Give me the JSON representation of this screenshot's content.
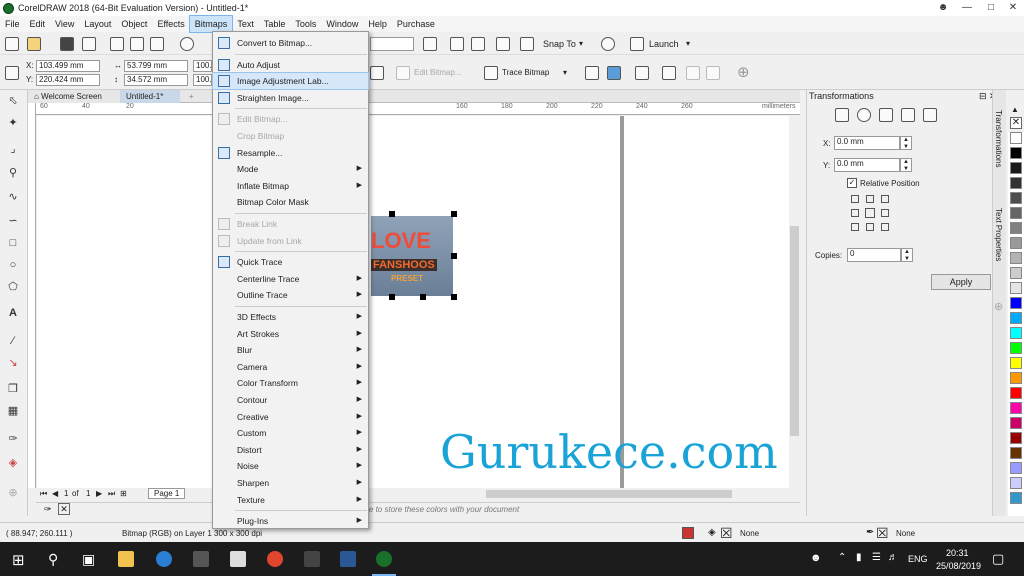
{
  "window": {
    "title": "CorelDRAW 2018 (64-Bit Evaluation Version) - Untitled-1*"
  },
  "menubar": [
    "File",
    "Edit",
    "View",
    "Layout",
    "Object",
    "Effects",
    "Bitmaps",
    "Text",
    "Table",
    "Tools",
    "Window",
    "Help",
    "Purchase"
  ],
  "std_toolbar": {
    "snap_to": "Snap To",
    "launch": "Launch"
  },
  "property_bar": {
    "x": "103.499 mm",
    "y": "220.424 mm",
    "w": "53.799 mm",
    "h": "34.572 mm",
    "scale_x": "100.",
    "scale_y": "100.",
    "edit_bitmap": "Edit Bitmap...",
    "trace_bitmap": "Trace Bitmap"
  },
  "doc_tabs": {
    "welcome": "Welcome Screen",
    "doc": "Untitled-1*"
  },
  "ruler": {
    "units": "millimeters",
    "numbers": [
      "60",
      "40",
      "20",
      "",
      "160",
      "180",
      "200",
      "220",
      "240",
      "260"
    ]
  },
  "bitmaps_menu": {
    "items": [
      {
        "label": "Convert to Bitmap...",
        "enabled": true,
        "submenu": false,
        "icon": "convert-bitmap-icon"
      },
      {
        "sep": true
      },
      {
        "label": "Auto Adjust",
        "enabled": true,
        "submenu": false,
        "icon": "auto-adjust-icon"
      },
      {
        "label": "Image Adjustment Lab...",
        "enabled": true,
        "submenu": false,
        "icon": "image-adjustment-icon",
        "highlighted": true
      },
      {
        "label": "Straighten Image...",
        "enabled": true,
        "submenu": false,
        "icon": "straighten-icon"
      },
      {
        "sep": true
      },
      {
        "label": "Edit Bitmap...",
        "enabled": false,
        "submenu": false,
        "icon": "edit-bitmap-icon"
      },
      {
        "label": "Crop Bitmap",
        "enabled": false,
        "submenu": false,
        "icon": ""
      },
      {
        "label": "Resample...",
        "enabled": true,
        "submenu": false,
        "icon": "resample-icon"
      },
      {
        "label": "Mode",
        "enabled": true,
        "submenu": true,
        "icon": ""
      },
      {
        "label": "Inflate Bitmap",
        "enabled": true,
        "submenu": true,
        "icon": ""
      },
      {
        "label": "Bitmap Color Mask",
        "enabled": true,
        "submenu": false,
        "icon": ""
      },
      {
        "sep": true
      },
      {
        "label": "Break Link",
        "enabled": false,
        "submenu": false,
        "icon": "break-link-icon"
      },
      {
        "label": "Update from Link",
        "enabled": false,
        "submenu": false,
        "icon": "update-link-icon"
      },
      {
        "sep": true
      },
      {
        "label": "Quick Trace",
        "enabled": true,
        "submenu": false,
        "icon": "quick-trace-icon"
      },
      {
        "label": "Centerline Trace",
        "enabled": true,
        "submenu": true,
        "icon": ""
      },
      {
        "label": "Outline Trace",
        "enabled": true,
        "submenu": true,
        "icon": ""
      },
      {
        "sep": true
      },
      {
        "label": "3D Effects",
        "enabled": true,
        "submenu": true,
        "icon": ""
      },
      {
        "label": "Art Strokes",
        "enabled": true,
        "submenu": true,
        "icon": ""
      },
      {
        "label": "Blur",
        "enabled": true,
        "submenu": true,
        "icon": ""
      },
      {
        "label": "Camera",
        "enabled": true,
        "submenu": true,
        "icon": ""
      },
      {
        "label": "Color Transform",
        "enabled": true,
        "submenu": true,
        "icon": ""
      },
      {
        "label": "Contour",
        "enabled": true,
        "submenu": true,
        "icon": ""
      },
      {
        "label": "Creative",
        "enabled": true,
        "submenu": true,
        "icon": ""
      },
      {
        "label": "Custom",
        "enabled": true,
        "submenu": true,
        "icon": ""
      },
      {
        "label": "Distort",
        "enabled": true,
        "submenu": true,
        "icon": ""
      },
      {
        "label": "Noise",
        "enabled": true,
        "submenu": true,
        "icon": ""
      },
      {
        "label": "Sharpen",
        "enabled": true,
        "submenu": true,
        "icon": ""
      },
      {
        "label": "Texture",
        "enabled": true,
        "submenu": true,
        "icon": ""
      },
      {
        "sep": true
      },
      {
        "label": "Plug-Ins",
        "enabled": true,
        "submenu": true,
        "icon": ""
      }
    ]
  },
  "bitmap_text": {
    "line1": "LOVE",
    "line2": "FANSHOOS",
    "line3": "PRESET"
  },
  "watermark": "Gurukece.com",
  "page_nav": {
    "current": "1",
    "of": "of",
    "total": "1",
    "page_tab": "Page 1"
  },
  "colorwell_hint": "jects) here to store these colors with your document",
  "status": {
    "coords": "( 88.947; 260.111 )",
    "info": "Bitmap (RGB) on Layer 1 300 x 300 dpi",
    "fill": "None",
    "outline": "None"
  },
  "docker": {
    "title": "Transformations",
    "x_label": "X:",
    "x_value": "0.0 mm",
    "y_label": "Y:",
    "y_value": "0.0 mm",
    "relative_position": "Relative Position",
    "copies_label": "Copies:",
    "copies_value": "0",
    "apply": "Apply",
    "side_tabs": [
      "Transformations",
      "Text Properties"
    ]
  },
  "palette_colors": [
    "#ffffff",
    "#000000",
    "#1a1a1a",
    "#333333",
    "#4d4d4d",
    "#666666",
    "#808080",
    "#999999",
    "#b3b3b3",
    "#cccccc",
    "#e6e6e6",
    "#0000ff",
    "#00aaff",
    "#00ffff",
    "#00ff00",
    "#ffff00",
    "#ff9900",
    "#ff0000",
    "#ff00aa",
    "#cc0066",
    "#990000",
    "#663300",
    "#9999ff",
    "#ccccff",
    "#3399cc"
  ],
  "taskbar": {
    "lang": "ENG",
    "time": "20:31",
    "date": "25/08/2019"
  }
}
